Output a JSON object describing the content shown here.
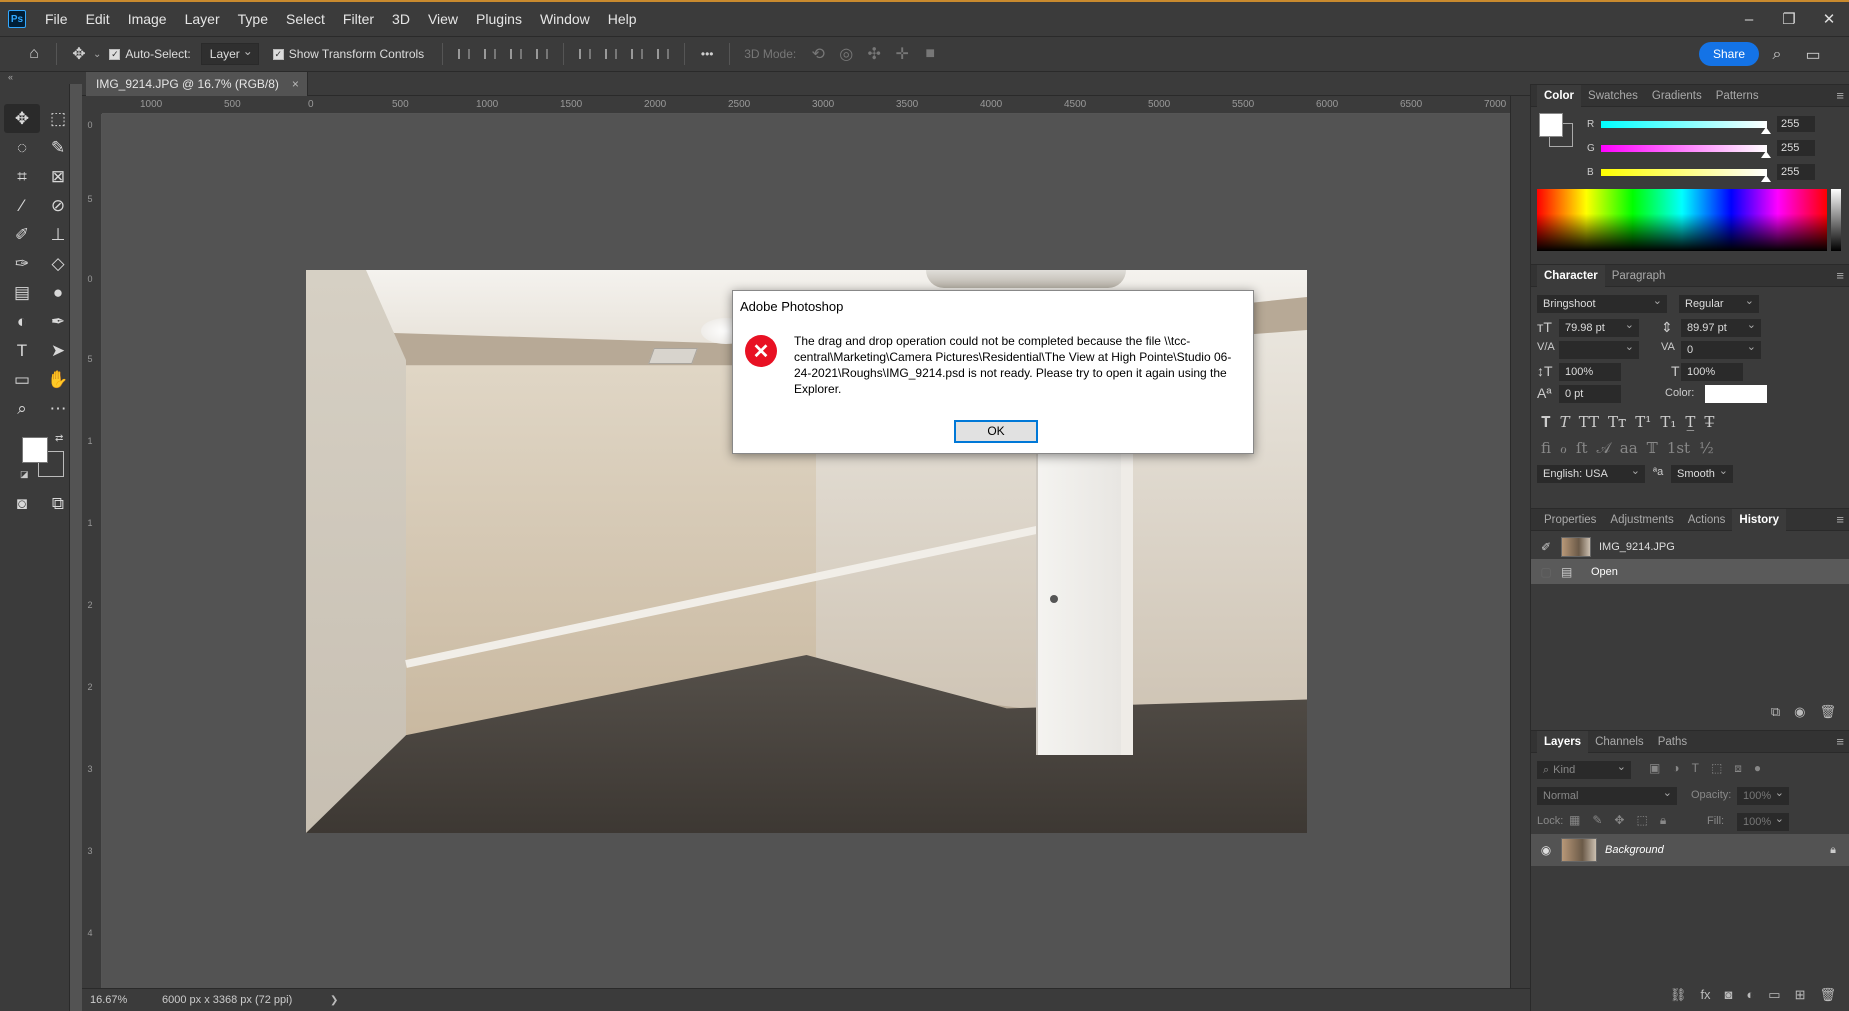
{
  "menu": [
    "File",
    "Edit",
    "Image",
    "Layer",
    "Type",
    "Select",
    "Filter",
    "3D",
    "View",
    "Plugins",
    "Window",
    "Help"
  ],
  "app_logo": "Ps",
  "window_controls": {
    "minimize": "–",
    "restore": "❐",
    "close": "✕"
  },
  "options_bar": {
    "auto_select_label": "Auto-Select:",
    "auto_select_checked": true,
    "layer_select": "Layer",
    "show_transform_label": "Show Transform Controls",
    "show_transform_checked": true,
    "more": "•••",
    "mode_3d": "3D Mode:",
    "share": "Share"
  },
  "document": {
    "tab_title": "IMG_9214.JPG @ 16.7% (RGB/8)",
    "zoom": "16.67%",
    "doc_info": "6000 px x 3368 px (72 ppi)",
    "status_arrow": "❯"
  },
  "ruler_h": [
    "1000",
    "500",
    "0",
    "500",
    "1000",
    "1500",
    "2000",
    "2500",
    "3000",
    "3500",
    "4000",
    "4500",
    "5000",
    "5500",
    "6000",
    "6500",
    "7000"
  ],
  "ruler_v": [
    "0",
    "5",
    "0",
    "5",
    "1",
    "1",
    "2",
    "2",
    "3",
    "3",
    "4"
  ],
  "dialog": {
    "title": "Adobe Photoshop",
    "message": "The drag and drop operation could not be completed because the file \\\\tcc-central\\Marketing\\Camera Pictures\\Residential\\The View at High Pointe\\Studio 06-24-2021\\Roughs\\IMG_9214.psd is not ready. Please try to open it again using the Explorer.",
    "ok": "OK"
  },
  "color_panel": {
    "tabs": [
      "Color",
      "Swatches",
      "Gradients",
      "Patterns"
    ],
    "r": {
      "label": "R",
      "value": "255",
      "color": "#00ffff"
    },
    "g": {
      "label": "G",
      "value": "255",
      "color": "#ff00ff"
    },
    "b": {
      "label": "B",
      "value": "255",
      "color": "#ffff00"
    }
  },
  "character_panel": {
    "tabs": [
      "Character",
      "Paragraph"
    ],
    "font_family": "Bringshoot",
    "font_style": "Regular",
    "size": "79.98 pt",
    "leading": "89.97 pt",
    "kerning": "",
    "tracking": "0",
    "vscale": "100%",
    "hscale": "100%",
    "baseline": "0 pt",
    "color_label": "Color:",
    "language": "English: USA",
    "aa_label": "ªa",
    "antialias": "Smooth"
  },
  "history_panel": {
    "tabs": [
      "Properties",
      "Adjustments",
      "Actions",
      "History"
    ],
    "snapshot": "IMG_9214.JPG",
    "steps": [
      "Open"
    ]
  },
  "layers_panel": {
    "tabs": [
      "Layers",
      "Channels",
      "Paths"
    ],
    "kind": "Kind",
    "blend": "Normal",
    "opacity_label": "Opacity:",
    "opacity": "100%",
    "lock_label": "Lock:",
    "fill_label": "Fill:",
    "fill": "100%",
    "layer_name": "Background"
  }
}
